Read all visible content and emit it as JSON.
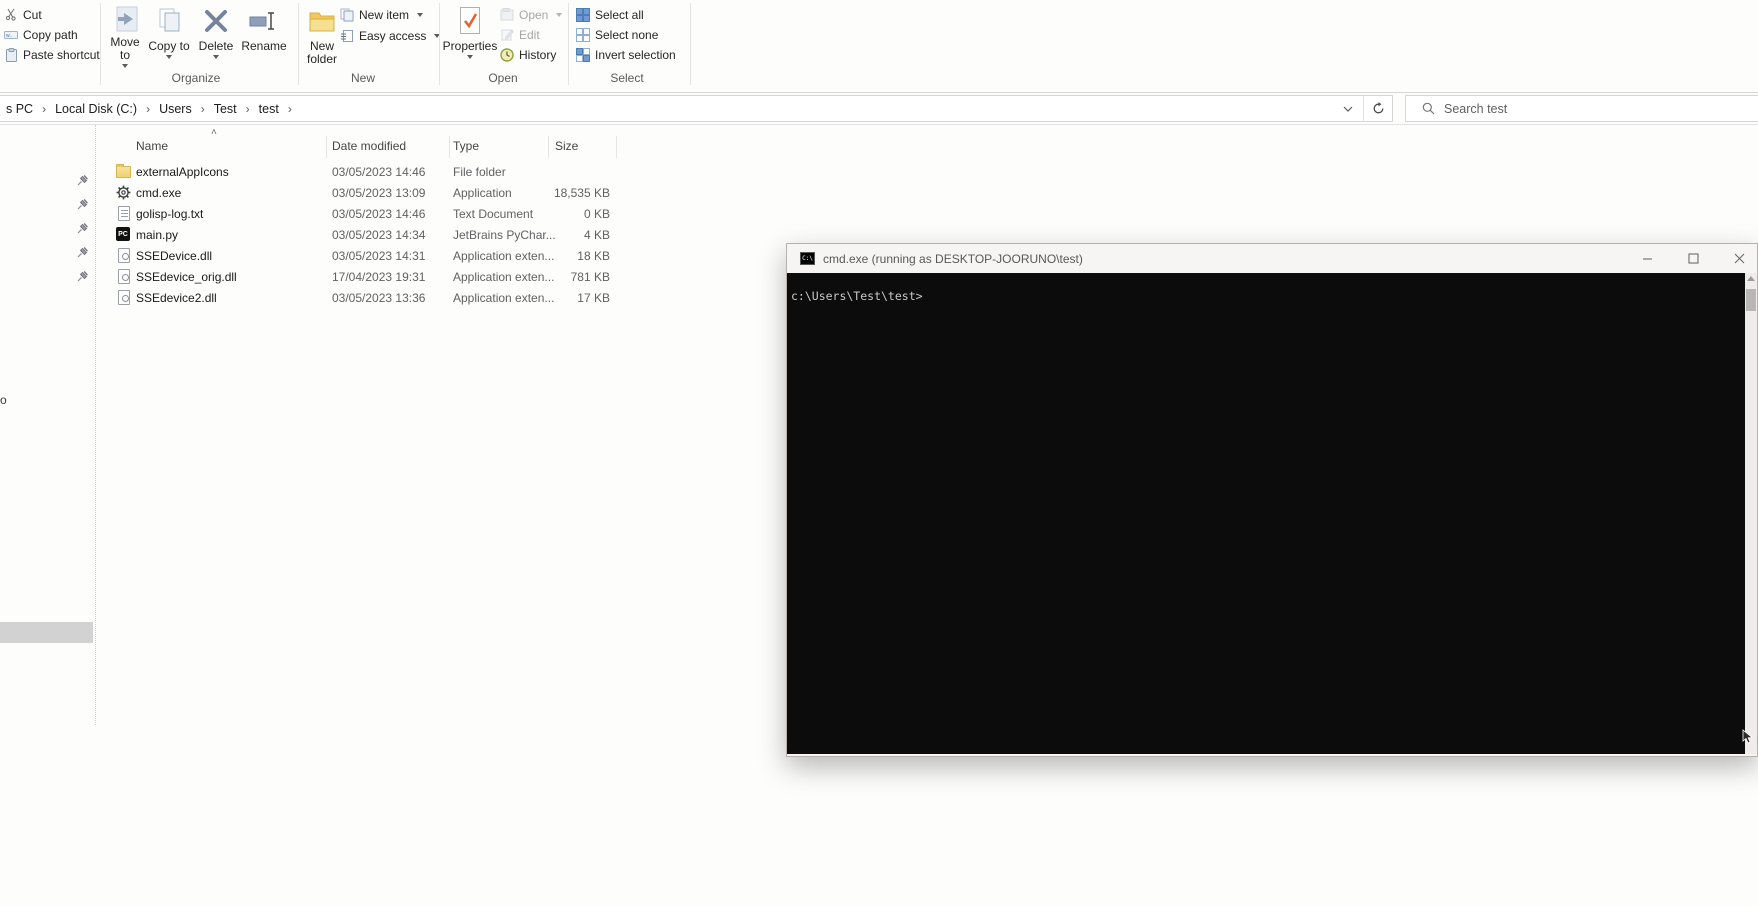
{
  "ribbon": {
    "clipboard": {
      "cut": "Cut",
      "copy_path": "Copy path",
      "paste_shortcut": "Paste shortcut"
    },
    "organize": {
      "label": "Organize",
      "move_to": "Move to",
      "copy_to": "Copy to",
      "delete": "Delete",
      "rename": "Rename"
    },
    "new": {
      "label": "New",
      "new_folder": "New folder",
      "new_item": "New item",
      "easy_access": "Easy access"
    },
    "open": {
      "label": "Open",
      "properties": "Properties",
      "open": "Open",
      "edit": "Edit",
      "history": "History"
    },
    "select": {
      "label": "Select",
      "select_all": "Select all",
      "select_none": "Select none",
      "invert_selection": "Invert selection"
    }
  },
  "address_bar": {
    "breadcrumb": [
      "s PC",
      "Local Disk (C:)",
      "Users",
      "Test",
      "test"
    ],
    "search_placeholder": "Search test"
  },
  "file_list": {
    "columns": {
      "name": "Name",
      "date": "Date modified",
      "type": "Type",
      "size": "Size"
    },
    "rows": [
      {
        "name": "externalAppIcons",
        "date": "03/05/2023 14:46",
        "type": "File folder",
        "size": "",
        "icon": "folder"
      },
      {
        "name": "cmd.exe",
        "date": "03/05/2023 13:09",
        "type": "Application",
        "size": "18,535 KB",
        "icon": "gear"
      },
      {
        "name": "golisp-log.txt",
        "date": "03/05/2023 14:46",
        "type": "Text Document",
        "size": "0 KB",
        "icon": "text"
      },
      {
        "name": "main.py",
        "date": "03/05/2023 14:34",
        "type": "JetBrains PyChar...",
        "size": "4 KB",
        "icon": "pycharm"
      },
      {
        "name": "SSEDevice.dll",
        "date": "03/05/2023 14:31",
        "type": "Application exten...",
        "size": "18 KB",
        "icon": "dll"
      },
      {
        "name": "SSEdevice_orig.dll",
        "date": "17/04/2023 19:31",
        "type": "Application exten...",
        "size": "781 KB",
        "icon": "dll"
      },
      {
        "name": "SSEdevice2.dll",
        "date": "03/05/2023 13:36",
        "type": "Application exten...",
        "size": "17 KB",
        "icon": "dll"
      }
    ]
  },
  "nav": {
    "pin_count": 5,
    "cut_text": "o"
  },
  "cmd_window": {
    "title": "cmd.exe (running as DESKTOP-JOORUNO\\test)",
    "prompt": "c:\\Users\\Test\\test>"
  },
  "colors": {
    "console_bg": "#0c0c0c",
    "console_text": "#c9c9c9",
    "folder_yellow": "#f1d071",
    "properties_check_orange": "#e8622b",
    "select_icon_blue": "#6f9bd1",
    "ribbon_text": "#262626",
    "disabled_text": "#a6a6a6",
    "selected_nav_gray": "#d2d2d2"
  }
}
